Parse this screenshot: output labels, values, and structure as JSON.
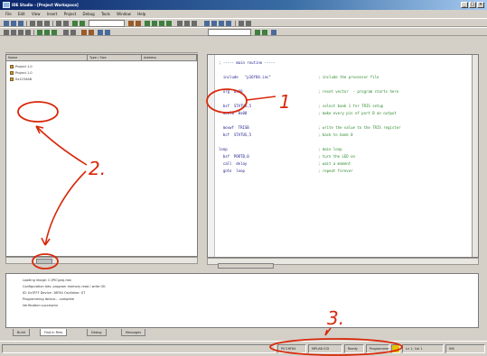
{
  "window": {
    "title": "IDE Studio - [Project Workspace]",
    "controls": [
      "_",
      "□",
      "×"
    ]
  },
  "menubar": {
    "items": [
      "File",
      "Edit",
      "View",
      "Insert",
      "Project",
      "Debug",
      "Tools",
      "Window",
      "Help"
    ]
  },
  "toolbar": {
    "combo_1": "",
    "combo_2": ""
  },
  "left_pane": {
    "columns": [
      "Name",
      "Type / Size",
      "Address"
    ],
    "items": [
      "Project 1.0",
      "Project 1.0",
      "0x1234AB"
    ]
  },
  "code": {
    "lines": [
      {
        "ins": "; ----- main routine -----",
        "cmt": ""
      },
      {
        "ins": "",
        "cmt": ""
      },
      {
        "ins": "  include   \"p16f84.inc\"",
        "cmt": "; include the processor file"
      },
      {
        "ins": "",
        "cmt": ""
      },
      {
        "ins": "  org  0x00",
        "cmt": "; reset vector  - program starts here"
      },
      {
        "ins": "",
        "cmt": ""
      },
      {
        "ins": "  bsf  STATUS,5",
        "cmt": "; select bank 1 for TRIS setup"
      },
      {
        "ins": "  movlw  0x00",
        "cmt": "; make every pin of port B an output"
      },
      {
        "ins": "",
        "cmt": ""
      },
      {
        "ins": "  movwf  TRISB",
        "cmt": "; write the value to the TRIS register"
      },
      {
        "ins": "  bcf  STATUS,5",
        "cmt": "; back to bank 0"
      },
      {
        "ins": "",
        "cmt": ""
      },
      {
        "ins": "loop",
        "cmt": "; main loop"
      },
      {
        "ins": "  bsf  PORTB,0",
        "cmt": "; turn the LED on"
      },
      {
        "ins": "  call  delay",
        "cmt": "; wait a moment"
      },
      {
        "ins": "  goto  loop",
        "cmt": "; repeat forever"
      }
    ]
  },
  "output": {
    "lines": [
      "Loading image: C:\\PIC\\proj.hex",
      "Configuration bits: program memory read / write OK",
      "ID: 0x3FFF  Device: 16F84  Oscillator: XT",
      "Programming device... complete",
      "Verification successful"
    ],
    "tabs": [
      "Build",
      "Find in Files",
      "Debug",
      "Messages"
    ]
  },
  "status": {
    "cells": [
      "PIC16F84",
      "MPLAB ICD",
      "Ready",
      "Programmer",
      "",
      "Ln 1, Col 1",
      "INS"
    ]
  },
  "annotations": {
    "labels": [
      "1",
      "2.",
      "3."
    ],
    "color": "#d8280a"
  }
}
